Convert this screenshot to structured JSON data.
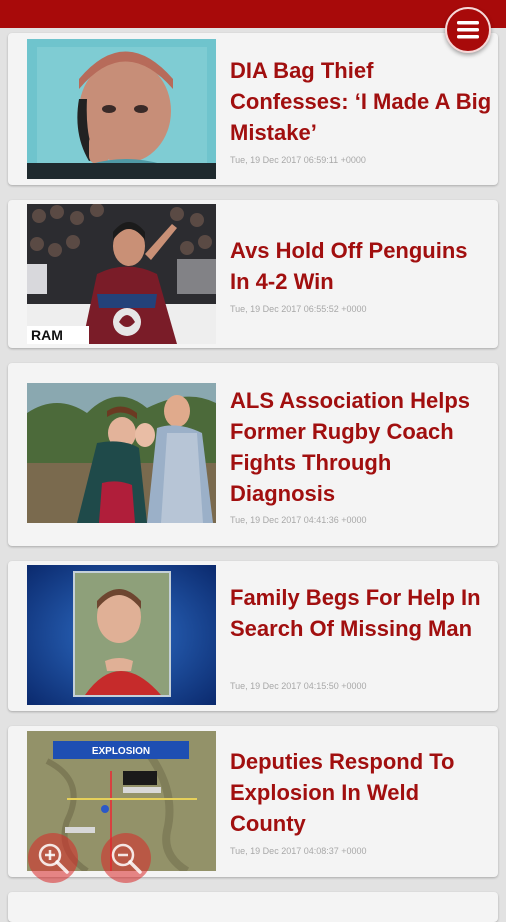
{
  "app": {
    "accent_color": "#a80a0a",
    "headline_color": "#a10f0f",
    "menu_icon": "hamburger-menu-icon",
    "zoom_in_icon": "zoom-in-icon",
    "zoom_out_icon": "zoom-out-icon"
  },
  "articles": [
    {
      "title": "DIA Bag Thief Confesses: ‘I Made A Big Mistake’",
      "date": "Tue, 19 Dec 2017 06:59:11 +0000",
      "thumbnail": "man-in-interrogation-room-photo"
    },
    {
      "title": "Avs Hold Off Penguins In 4-2 Win",
      "date": "Tue, 19 Dec 2017 06:55:52 +0000",
      "thumbnail": "hockey-player-celebrating-photo",
      "thumb_text": "RAM"
    },
    {
      "title": "ALS Association Helps Former Rugby Coach Fights Through Diagnosis",
      "date": "Tue, 19 Dec 2017 04:41:36 +0000",
      "thumbnail": "family-portrait-photo"
    },
    {
      "title": "Family Begs For Help In Search Of Missing Man",
      "date": "Tue, 19 Dec 2017 04:15:50 +0000",
      "thumbnail": "missing-man-portrait-photo"
    },
    {
      "title": "Deputies Respond To Explosion In Weld County",
      "date": "Tue, 19 Dec 2017 04:08:37 +0000",
      "thumbnail": "explosion-map-graphic",
      "thumb_text": "EXPLOSION"
    }
  ]
}
